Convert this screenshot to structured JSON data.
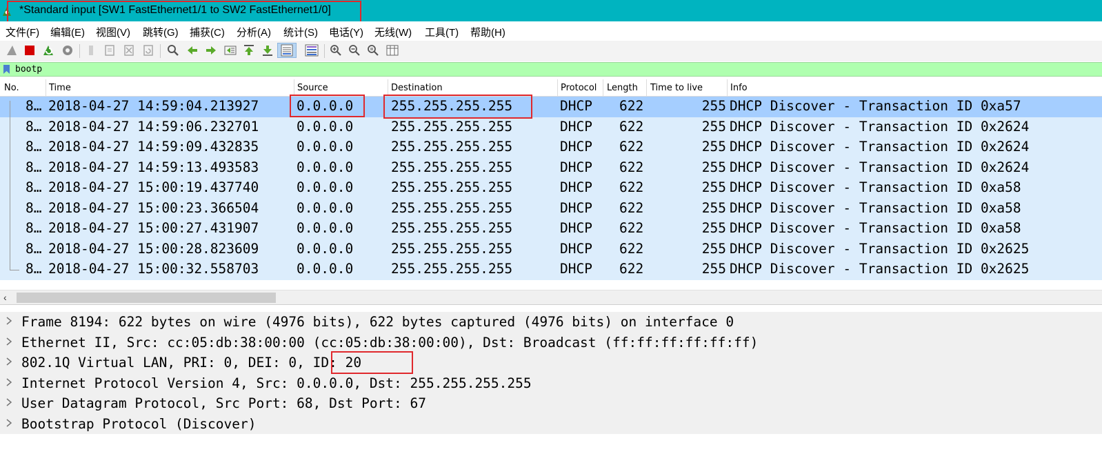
{
  "window": {
    "title": "*Standard input [SW1 FastEthernet1/1 to SW2 FastEthernet1/0]",
    "app_icon": "wireshark-fin-icon"
  },
  "menu": [
    "文件(F)",
    "编辑(E)",
    "视图(V)",
    "跳转(G)",
    "捕获(C)",
    "分析(A)",
    "统计(S)",
    "电话(Y)",
    "无线(W)",
    "工具(T)",
    "帮助(H)"
  ],
  "toolbar": {
    "icons": [
      "start-capture-icon",
      "stop-capture-icon",
      "restart-capture-icon",
      "capture-options-icon",
      "open-file-icon",
      "save-file-icon",
      "close-file-icon",
      "reload-file-icon",
      "find-packet-icon",
      "go-back-icon",
      "go-forward-icon",
      "go-to-packet-icon",
      "go-first-packet-icon",
      "go-last-packet-icon",
      "auto-scroll-icon",
      "colorize-icon",
      "zoom-in-icon",
      "zoom-out-icon",
      "normal-size-icon",
      "resize-columns-icon"
    ]
  },
  "filter": {
    "value": "bootp",
    "icon": "bookmark-icon"
  },
  "columns": [
    "No.",
    "Time",
    "Source",
    "Destination",
    "Protocol",
    "Length",
    "Time to live",
    "Info"
  ],
  "packets": [
    {
      "no": "8…",
      "time": "2018-04-27 14:59:04.213927",
      "source": "0.0.0.0",
      "destination": "255.255.255.255",
      "protocol": "DHCP",
      "length": "622",
      "ttl": "255",
      "info": "DHCP Discover - Transaction ID 0xa57"
    },
    {
      "no": "8…",
      "time": "2018-04-27 14:59:06.232701",
      "source": "0.0.0.0",
      "destination": "255.255.255.255",
      "protocol": "DHCP",
      "length": "622",
      "ttl": "255",
      "info": "DHCP Discover - Transaction ID 0x2624"
    },
    {
      "no": "8…",
      "time": "2018-04-27 14:59:09.432835",
      "source": "0.0.0.0",
      "destination": "255.255.255.255",
      "protocol": "DHCP",
      "length": "622",
      "ttl": "255",
      "info": "DHCP Discover - Transaction ID 0x2624"
    },
    {
      "no": "8…",
      "time": "2018-04-27 14:59:13.493583",
      "source": "0.0.0.0",
      "destination": "255.255.255.255",
      "protocol": "DHCP",
      "length": "622",
      "ttl": "255",
      "info": "DHCP Discover - Transaction ID 0x2624"
    },
    {
      "no": "8…",
      "time": "2018-04-27 15:00:19.437740",
      "source": "0.0.0.0",
      "destination": "255.255.255.255",
      "protocol": "DHCP",
      "length": "622",
      "ttl": "255",
      "info": "DHCP Discover - Transaction ID 0xa58"
    },
    {
      "no": "8…",
      "time": "2018-04-27 15:00:23.366504",
      "source": "0.0.0.0",
      "destination": "255.255.255.255",
      "protocol": "DHCP",
      "length": "622",
      "ttl": "255",
      "info": "DHCP Discover - Transaction ID 0xa58"
    },
    {
      "no": "8…",
      "time": "2018-04-27 15:00:27.431907",
      "source": "0.0.0.0",
      "destination": "255.255.255.255",
      "protocol": "DHCP",
      "length": "622",
      "ttl": "255",
      "info": "DHCP Discover - Transaction ID 0xa58"
    },
    {
      "no": "8…",
      "time": "2018-04-27 15:00:28.823609",
      "source": "0.0.0.0",
      "destination": "255.255.255.255",
      "protocol": "DHCP",
      "length": "622",
      "ttl": "255",
      "info": "DHCP Discover - Transaction ID 0x2625"
    },
    {
      "no": "8…",
      "time": "2018-04-27 15:00:32.558703",
      "source": "0.0.0.0",
      "destination": "255.255.255.255",
      "protocol": "DHCP",
      "length": "622",
      "ttl": "255",
      "info": "DHCP Discover - Transaction ID 0x2625"
    }
  ],
  "details": [
    "Frame 8194: 622 bytes on wire (4976 bits), 622 bytes captured (4976 bits) on interface 0",
    "Ethernet II, Src: cc:05:db:38:00:00 (cc:05:db:38:00:00), Dst: Broadcast (ff:ff:ff:ff:ff:ff)",
    "802.1Q Virtual LAN, PRI: 0, DEI: 0, ID: 20",
    "Internet Protocol Version 4, Src: 0.0.0.0, Dst: 255.255.255.255",
    "User Datagram Protocol, Src Port: 68, Dst Port: 67",
    "Bootstrap Protocol (Discover)"
  ],
  "colors": {
    "titlebar": "#00b4c0",
    "filter_bg": "#afffaf",
    "row_bg": "#dcedfc",
    "row_selected": "#a5ceff",
    "highlight_box": "#e0282c"
  }
}
